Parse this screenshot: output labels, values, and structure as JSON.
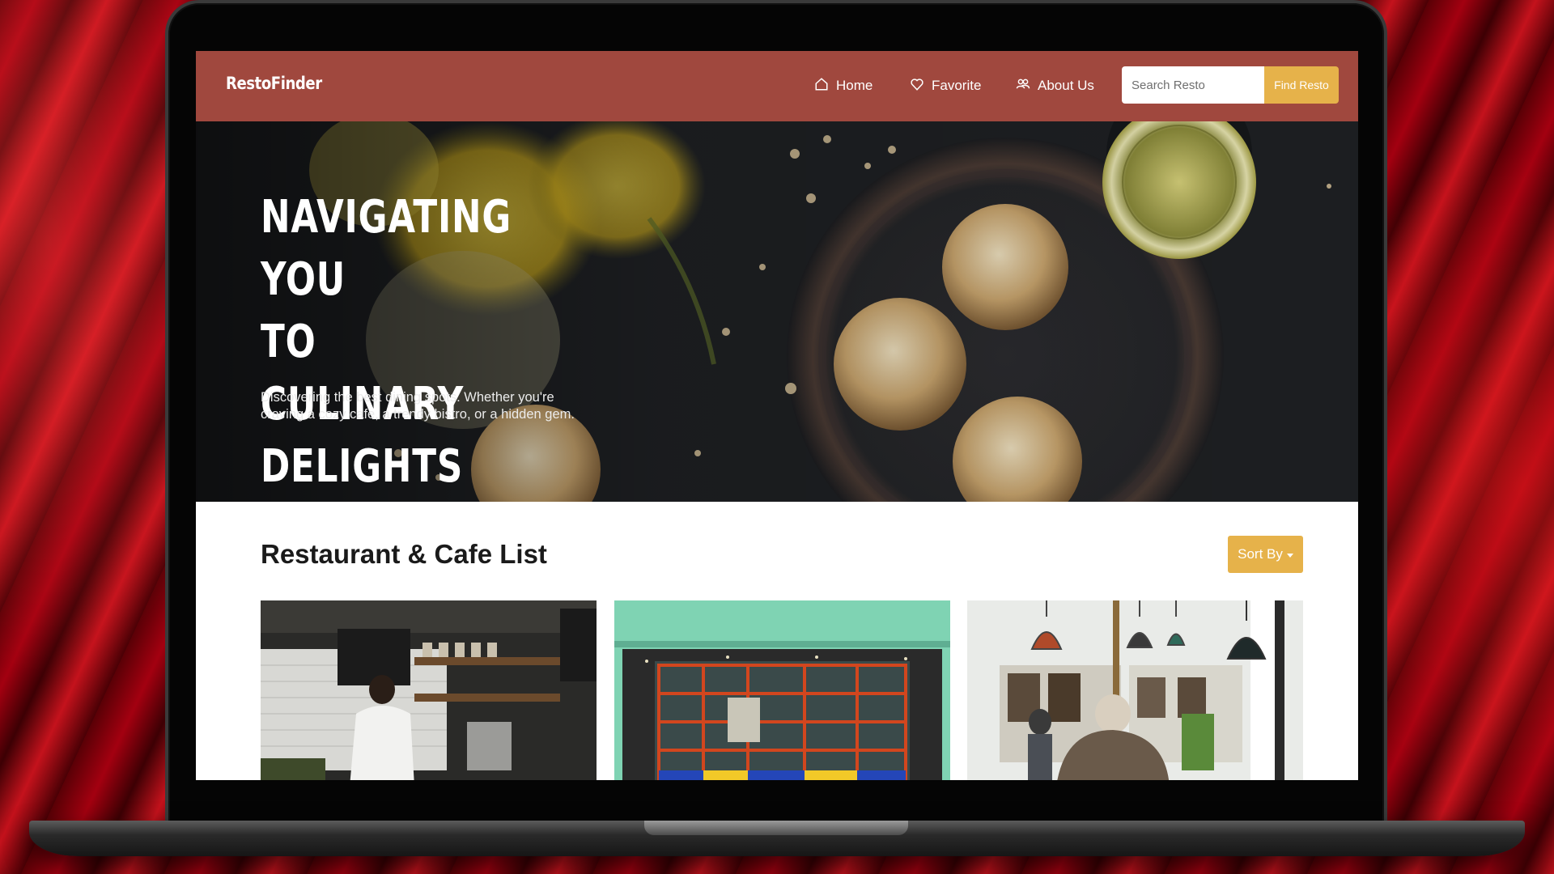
{
  "header": {
    "brand": "RestoFinder",
    "nav": [
      {
        "label": "Home",
        "icon": "home-icon"
      },
      {
        "label": "Favorite",
        "icon": "heart-icon"
      },
      {
        "label": "About Us",
        "icon": "users-icon"
      }
    ],
    "search": {
      "placeholder": "Search Resto",
      "value": "",
      "button_label": "Find Resto"
    }
  },
  "hero": {
    "title_lines": [
      "NAVIGATING YOU",
      "TO CULINARY",
      "DELIGHTS"
    ],
    "subtitle": "Discovering the best dining spots. Whether you're craving a cozy cafe, a trendy bistro, or a hidden gem."
  },
  "list_section": {
    "title": "Restaurant & Cafe List",
    "sort_label": "Sort By"
  },
  "cards": [
    {
      "image": "cafe-kitchen-photo"
    },
    {
      "image": "green-storefront-photo"
    },
    {
      "image": "window-cafe-photo"
    }
  ],
  "colors": {
    "navbar": "#a0483e",
    "accent": "#e6b24a",
    "hero_bg": "#1d1f22",
    "background": "#8b0010"
  }
}
